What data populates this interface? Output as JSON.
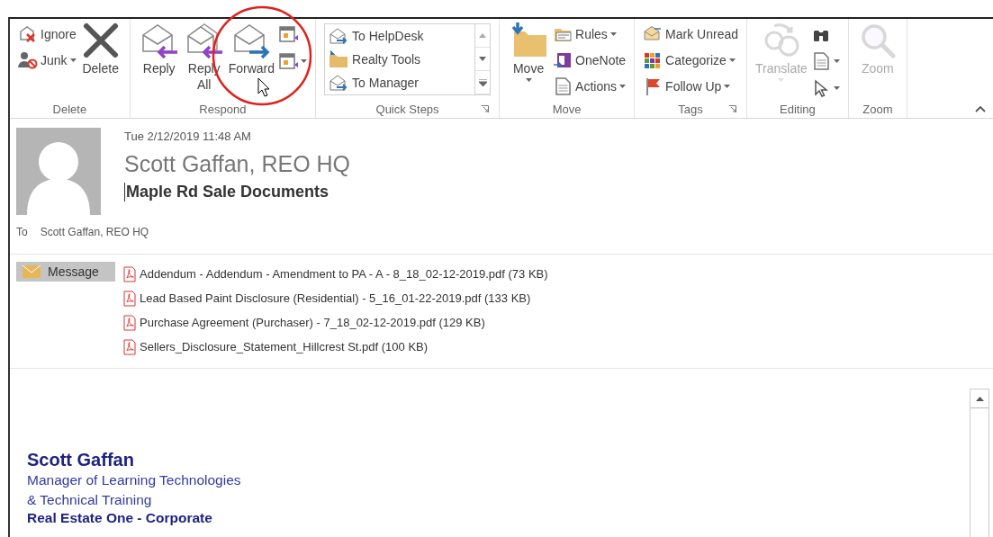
{
  "ribbon": {
    "groups": [
      {
        "label": "Delete",
        "launcher": false,
        "columns": [
          [
            {
              "kind": "small",
              "label": "Ignore",
              "dropdown": false,
              "disabled": false
            },
            {
              "kind": "small",
              "label": "Junk",
              "dropdown": true,
              "disabled": false
            }
          ],
          [
            {
              "kind": "large",
              "label": "Delete",
              "dropdown": false,
              "disabled": false
            }
          ]
        ]
      },
      {
        "label": "Respond",
        "launcher": false,
        "columns": [
          [
            {
              "kind": "large",
              "label": "Reply",
              "dropdown": false,
              "disabled": false
            }
          ],
          [
            {
              "kind": "large",
              "label": "Reply All",
              "dropdown": false,
              "disabled": false
            }
          ],
          [
            {
              "kind": "large",
              "label": "Forward",
              "dropdown": false,
              "disabled": false
            }
          ],
          [
            {
              "kind": "icon",
              "dropdown": false,
              "disabled": false
            },
            {
              "kind": "icon",
              "dropdown": true,
              "disabled": false
            }
          ]
        ]
      },
      {
        "label": "Quick Steps",
        "launcher": true,
        "gallery": [
          "To HelpDesk",
          "Realty Tools",
          "To Manager"
        ]
      },
      {
        "label": "Move",
        "launcher": false,
        "columns": [
          [
            {
              "kind": "large",
              "label": "Move",
              "dropdown": true,
              "disabled": false
            }
          ],
          [
            {
              "kind": "small",
              "label": "Rules",
              "dropdown": true,
              "disabled": false
            },
            {
              "kind": "small",
              "label": "OneNote",
              "dropdown": false,
              "disabled": false
            },
            {
              "kind": "small",
              "label": "Actions",
              "dropdown": true,
              "disabled": false
            }
          ]
        ]
      },
      {
        "label": "Tags",
        "launcher": true,
        "columns": [
          [
            {
              "kind": "small",
              "label": "Mark Unread",
              "dropdown": false,
              "disabled": false
            },
            {
              "kind": "small",
              "label": "Categorize",
              "dropdown": true,
              "disabled": false
            },
            {
              "kind": "small",
              "label": "Follow Up",
              "dropdown": true,
              "disabled": false
            }
          ]
        ]
      },
      {
        "label": "Editing",
        "launcher": false,
        "columns": [
          [
            {
              "kind": "large",
              "label": "Translate",
              "dropdown": true,
              "disabled": true
            }
          ],
          [
            {
              "kind": "icon",
              "dropdown": false,
              "disabled": false
            },
            {
              "kind": "icon",
              "dropdown": true,
              "disabled": false
            },
            {
              "kind": "icon",
              "dropdown": true,
              "disabled": false
            }
          ]
        ]
      },
      {
        "label": "Zoom",
        "launcher": false,
        "columns": [
          [
            {
              "kind": "large",
              "label": "Zoom",
              "dropdown": false,
              "disabled": true
            }
          ]
        ]
      }
    ]
  },
  "message": {
    "date": "Tue 2/12/2019 11:48 AM",
    "sender": "Scott Gaffan, REO HQ",
    "subject": "Maple Rd Sale Documents",
    "to_label": "To",
    "to": "Scott Gaffan, REO HQ"
  },
  "attachments": {
    "tab": {
      "label": "Message",
      "selected": true
    },
    "files": [
      "Addendum - Addendum - Amendment to PA - A - 8_18_02-12-2019.pdf (73 KB)",
      "Lead Based Paint Disclosure (Residential) - 5_16_01-22-2019.pdf (133 KB)",
      "Purchase Agreement (Purchaser) - 7_18_02-12-2019.pdf (129 KB)",
      "Sellers_Disclosure_Statement_Hillcrest St.pdf (100 KB)"
    ]
  },
  "signature": {
    "name": "Scott Gaffan",
    "lines": [
      "Manager of Learning Technologies",
      "& Technical Training"
    ],
    "company": "Real Estate One - Corporate"
  }
}
